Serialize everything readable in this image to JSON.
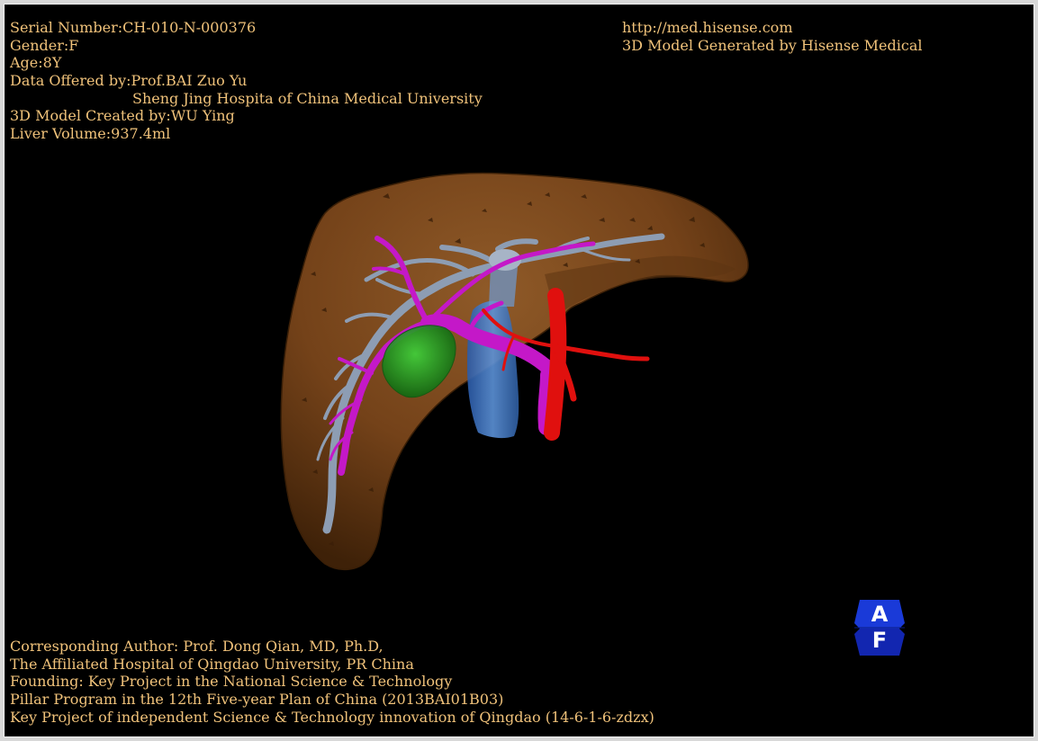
{
  "header": {
    "serial_number": "Serial Number:CH-010-N-000376",
    "gender": "Gender:F",
    "age": "Age:8Y",
    "data_offered_by": "Data Offered by:Prof.BAI Zuo Yu",
    "hospital": "Sheng Jing Hospita of China Medical University",
    "model_created_by": "3D Model Created by:WU Ying",
    "liver_volume": "Liver Volume:937.4ml"
  },
  "brand": {
    "url": "http://med.hisense.com",
    "generated_by": "3D Model Generated by Hisense Medical"
  },
  "footer": {
    "line1": "Corresponding Author: Prof. Dong Qian, MD, Ph.D,",
    "line2": "The Affiliated Hospital of Qingdao University, PR China",
    "line3": "Founding: Key Project in the National Science & Technology",
    "line4": "Pillar Program in the 12th Five-year Plan of China (2013BAI01B03)",
    "line5": "Key Project of independent Science & Technology innovation of Qingdao (14-6-1-6-zdzx)"
  },
  "orientation_cube": {
    "top_letter": "A",
    "front_letter": "F"
  },
  "colors": {
    "background": "#000000",
    "text": "#f0c27a",
    "liver": "#7a4a1f",
    "portal_vein": "#c418c8",
    "hepatic_vein": "#8a9ab0",
    "artery": "#e0100e",
    "vena_cava": "#3f78c4",
    "tumor": "#23a522",
    "cube": "#1530c8"
  }
}
